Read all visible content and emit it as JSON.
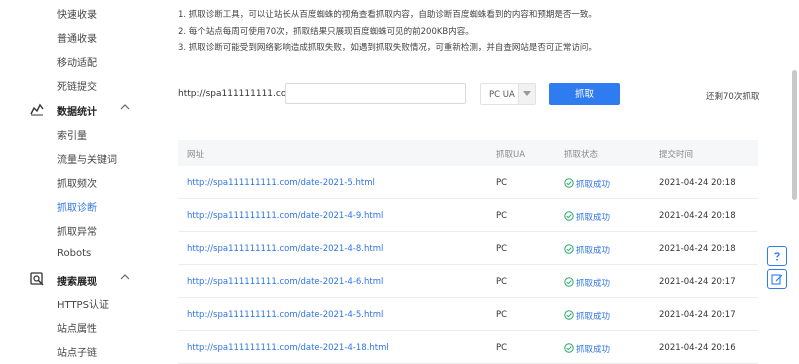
{
  "sidebar": {
    "items_top": [
      {
        "label": "快速收录"
      },
      {
        "label": "普通收录"
      },
      {
        "label": "移动适配"
      },
      {
        "label": "死链提交"
      }
    ],
    "section_stats": {
      "label": "数据统计",
      "icon": "chart-icon"
    },
    "items_stats": [
      {
        "label": "索引量"
      },
      {
        "label": "流量与关键词"
      },
      {
        "label": "抓取频次"
      },
      {
        "label": "抓取诊断"
      },
      {
        "label": "抓取异常"
      },
      {
        "label": "Robots"
      }
    ],
    "section_search": {
      "label": "搜索展现",
      "icon": "search-display-icon"
    },
    "items_search": [
      {
        "label": "HTTPS认证"
      },
      {
        "label": "站点属性"
      },
      {
        "label": "站点子链"
      }
    ]
  },
  "notes": [
    "1. 抓取诊断工具，可以让站长从百度蜘蛛的视角查看抓取内容，自助诊断百度蜘蛛看到的内容和预期是否一致。",
    "2. 每个站点每周可使用70次，抓取结果只展现百度蜘蛛可见的前200KB内容。",
    "3. 抓取诊断可能受到网络影响造成抓取失败，如遇到抓取失败情况，可重新检测，并自查网站是否可正常访问。"
  ],
  "fetch": {
    "url_prefix": "http://spa111111111.com/",
    "url_value": "",
    "ua_selected": "PC UA",
    "button_label": "抓取",
    "remaining_text": "还剩70次抓取"
  },
  "table": {
    "headers": [
      "网址",
      "抓取UA",
      "抓取状态",
      "提交时间"
    ],
    "rows": [
      {
        "url": "http://spa111111111.com/date-2021-5.html",
        "ua": "PC",
        "status": "抓取成功",
        "time": "2021-04-24 20:18"
      },
      {
        "url": "http://spa111111111.com/date-2021-4-9.html",
        "ua": "PC",
        "status": "抓取成功",
        "time": "2021-04-24 20:18"
      },
      {
        "url": "http://spa111111111.com/date-2021-4-8.html",
        "ua": "PC",
        "status": "抓取成功",
        "time": "2021-04-24 20:18"
      },
      {
        "url": "http://spa111111111.com/date-2021-4-6.html",
        "ua": "PC",
        "status": "抓取成功",
        "time": "2021-04-24 20:17"
      },
      {
        "url": "http://spa111111111.com/date-2021-4-5.html",
        "ua": "PC",
        "status": "抓取成功",
        "time": "2021-04-24 20:17"
      },
      {
        "url": "http://spa111111111.com/date-2021-4-18.html",
        "ua": "PC",
        "status": "抓取成功",
        "time": "2021-04-24 20:16"
      }
    ]
  },
  "colors": {
    "accent": "#2f7cf0",
    "link": "#2d74e6",
    "success": "#2d74e6"
  },
  "float_buttons": [
    {
      "icon": "help-icon"
    },
    {
      "icon": "feedback-icon"
    }
  ]
}
